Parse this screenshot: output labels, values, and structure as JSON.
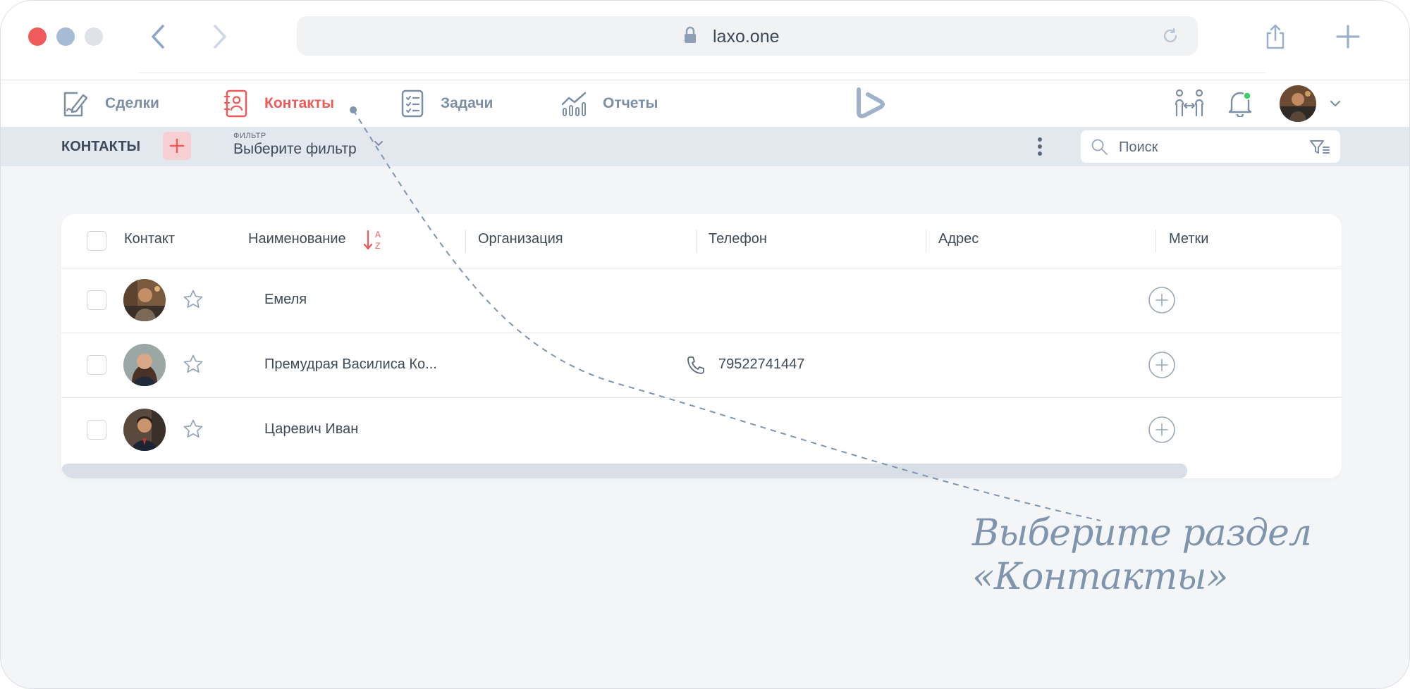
{
  "browser": {
    "url": "laxo.one",
    "colors": {
      "close": "#ef5b5b",
      "minimize": "#a8bbd6",
      "zoom": "#dfe2e6"
    }
  },
  "nav": {
    "items": [
      {
        "label": "Сделки",
        "icon": "deals-icon",
        "active": false
      },
      {
        "label": "Контакты",
        "icon": "contacts-icon",
        "active": true
      },
      {
        "label": "Задачи",
        "icon": "tasks-icon",
        "active": false
      },
      {
        "label": "Отчеты",
        "icon": "reports-icon",
        "active": false
      }
    ],
    "accent": "#ee5a5a",
    "muted": "#7d8fa6"
  },
  "toolbar": {
    "title": "КОНТАКТЫ",
    "filter_label": "ФИЛЬТР",
    "filter_value": "Выберите фильтр",
    "search_placeholder": "Поиск"
  },
  "table": {
    "columns": [
      "Контакт",
      "Наименование",
      "Организация",
      "Телефон",
      "Адрес",
      "Метки"
    ],
    "sorted_column": "Наименование",
    "rows": [
      {
        "name": "Емеля",
        "phone": ""
      },
      {
        "name": "Премудрая Василиса Ко...",
        "phone": "79522741447"
      },
      {
        "name": "Царевич Иван",
        "phone": ""
      }
    ]
  },
  "annotation": {
    "line1": "Выберите раздел",
    "line2": "«Контакты»"
  }
}
